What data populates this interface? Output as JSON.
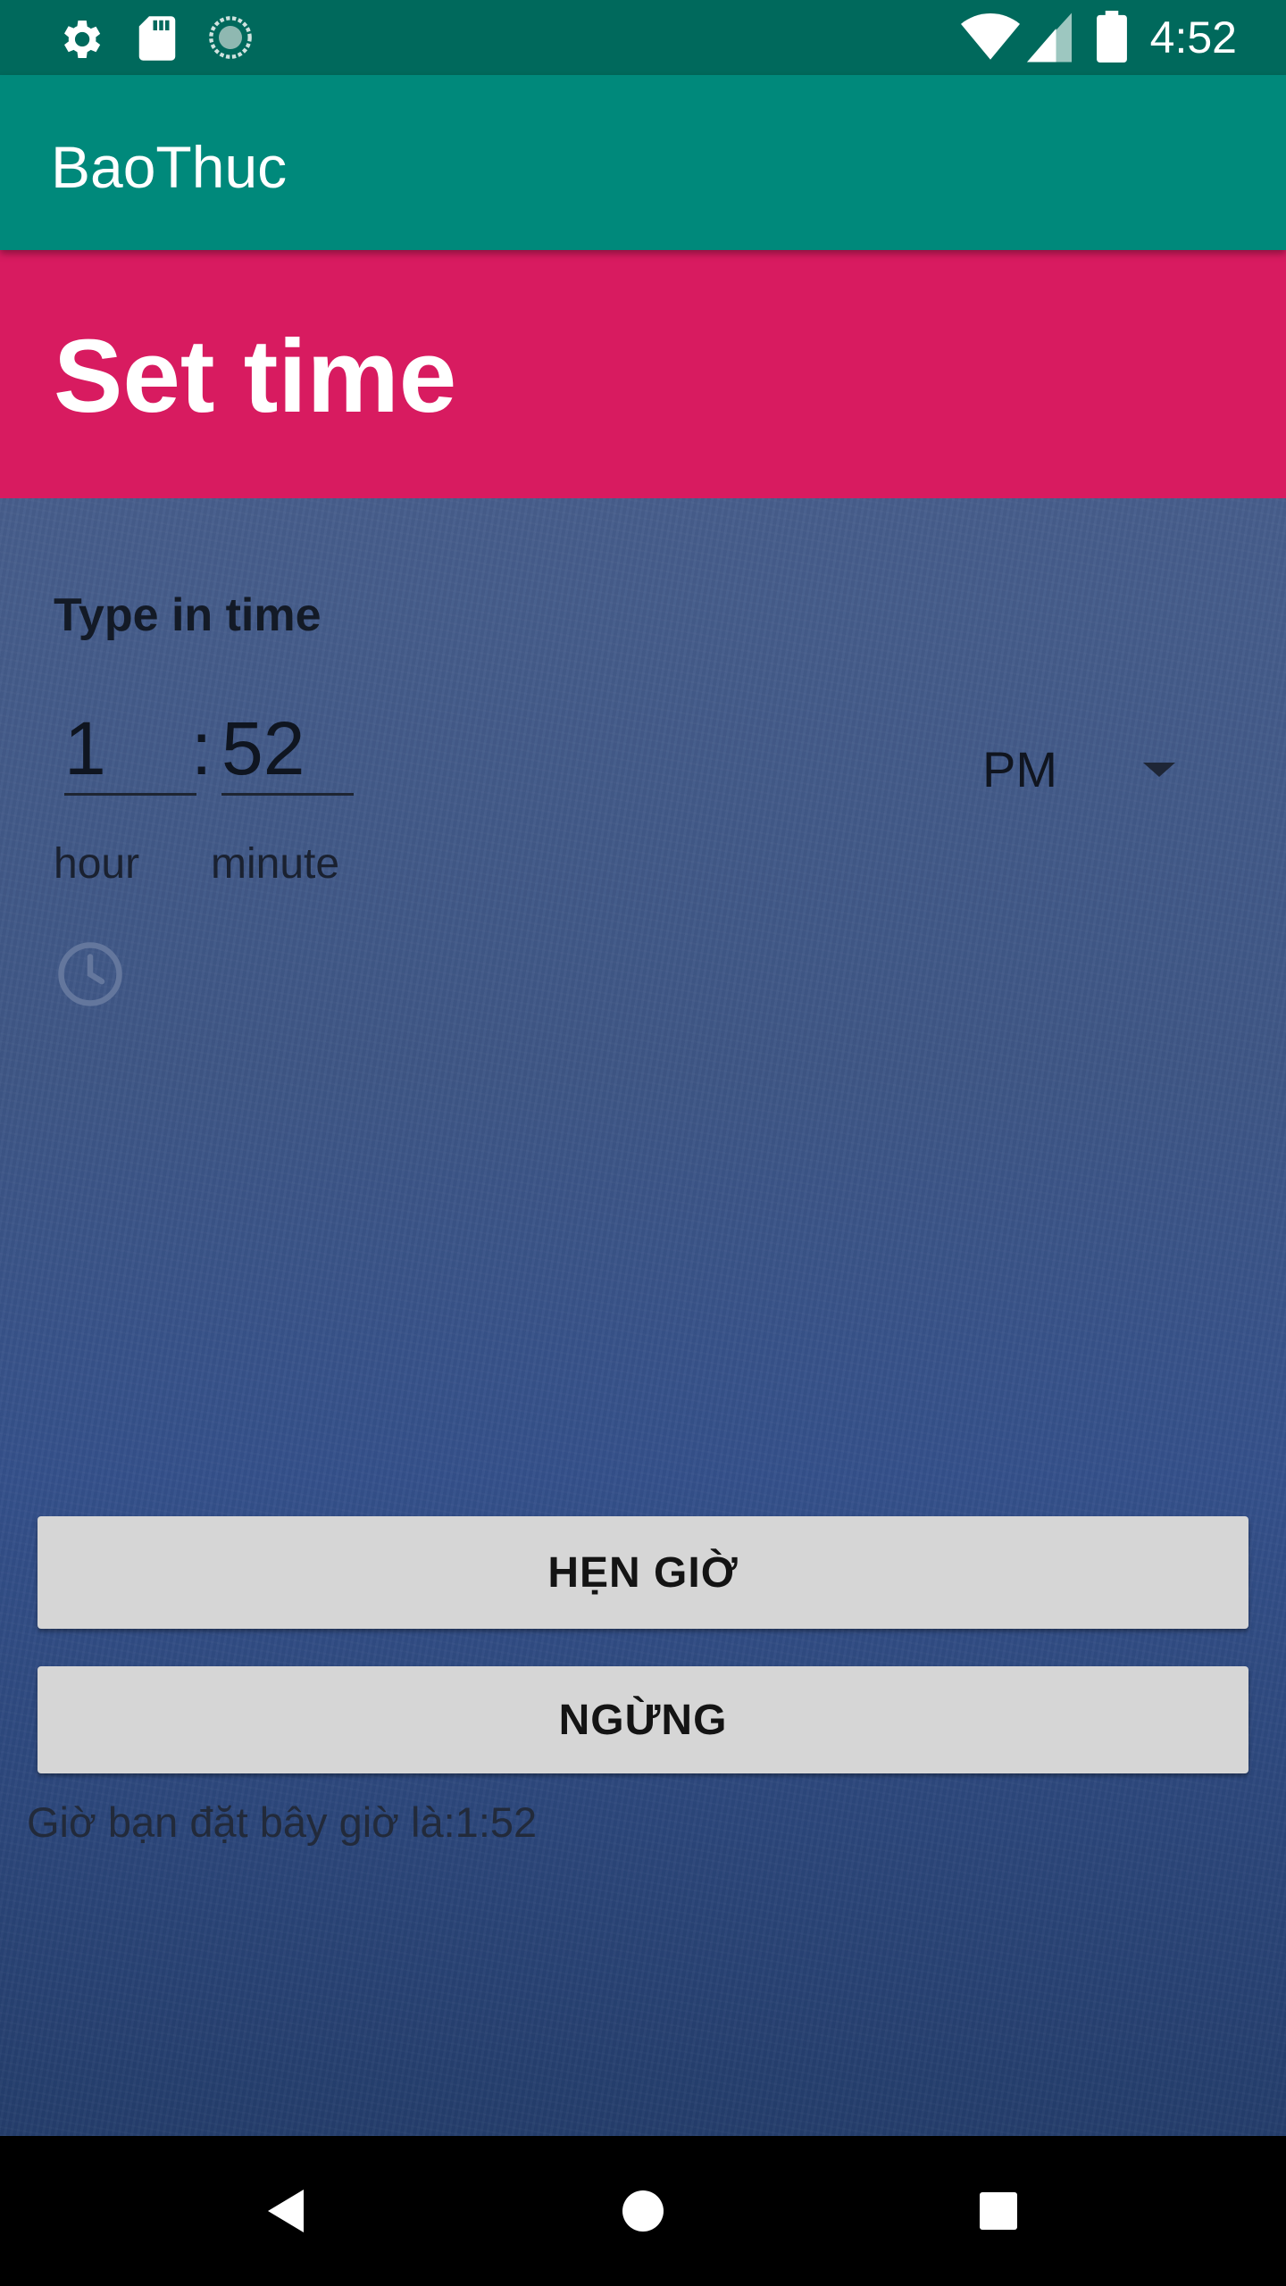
{
  "status_bar": {
    "time": "4:52",
    "left_icons": [
      "gear-icon",
      "sd-card-icon",
      "sync-icon"
    ],
    "right_icons": [
      "wifi-icon",
      "cellular-signal-icon",
      "battery-icon"
    ]
  },
  "app_bar": {
    "title": "BaoThuc"
  },
  "time_picker": {
    "header_title": "Set time",
    "input_label": "Type in time",
    "hour_value": "1",
    "separator": ":",
    "minute_value": "52",
    "hour_label": "hour",
    "minute_label": "minute",
    "ampm_selected": "PM",
    "mode_icon": "clock-icon"
  },
  "actions": {
    "set_label": "HẸN GIỜ",
    "stop_label": "NGỪNG"
  },
  "result": {
    "text": "Giờ bạn đặt bây giờ là:1:52"
  },
  "nav_bar": {
    "buttons": [
      "back-icon",
      "home-icon",
      "recents-icon"
    ]
  },
  "colors": {
    "status_bar": "#00695c",
    "app_bar": "#00897b",
    "picker_header": "#d81b60",
    "button_bg": "#d6d6d6"
  }
}
